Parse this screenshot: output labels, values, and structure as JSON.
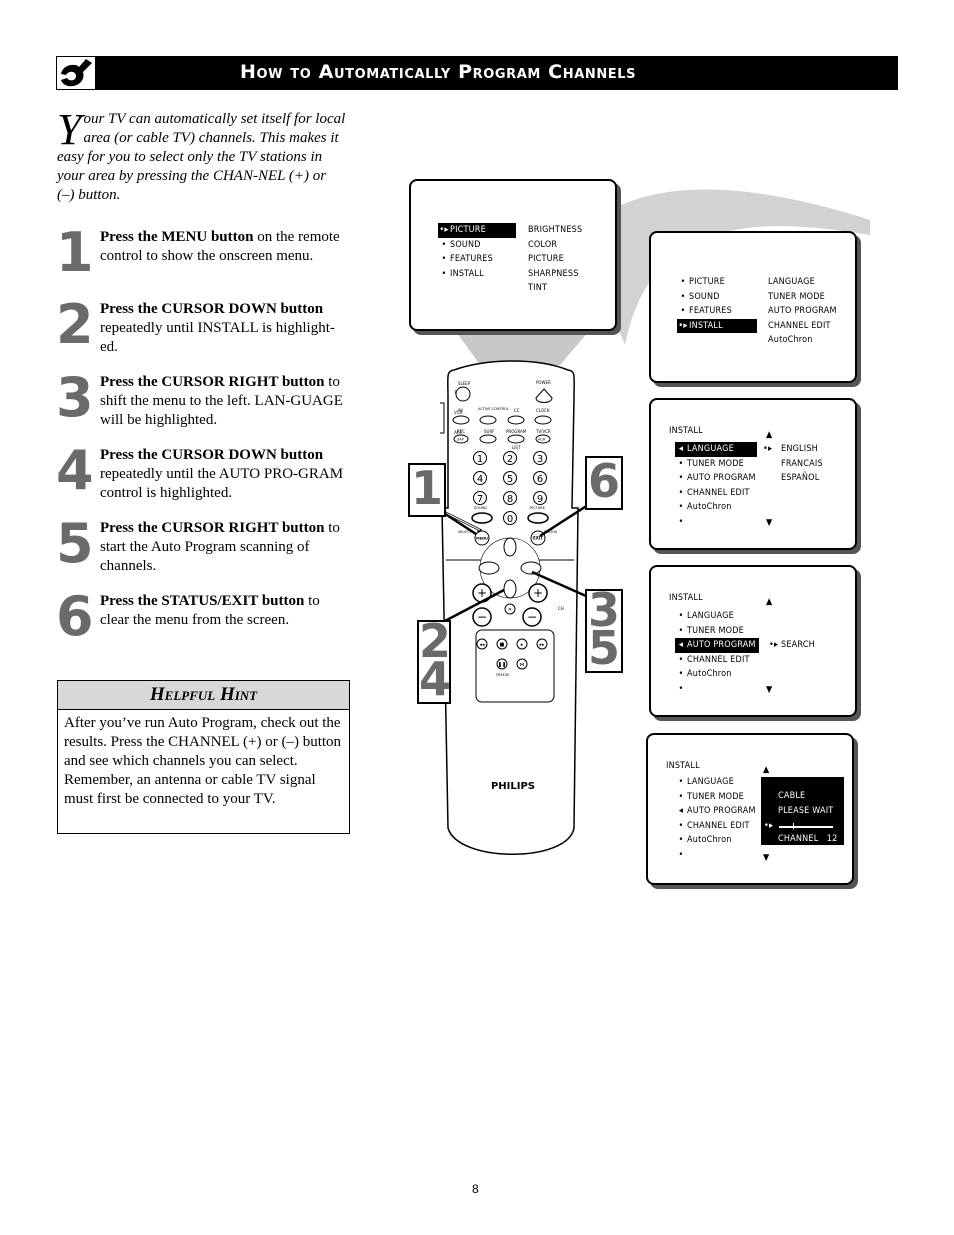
{
  "header": {
    "icon": "wrench-icon",
    "title": "How to Automatically Program Channels"
  },
  "intro": {
    "dropcap": "Y",
    "text": "our TV can automatically set itself for local area (or cable TV) channels.  This makes it easy for you to select only the TV stations in your area by pressing the CHAN-NEL (+) or (–) button."
  },
  "steps": [
    {
      "number": "1",
      "bold": "Press the MENU button",
      "text": " on the remote control to show the onscreen menu."
    },
    {
      "number": "2",
      "bold": "Press the CURSOR DOWN button",
      "text": " repeatedly until INSTALL is highlight-ed."
    },
    {
      "number": "3",
      "bold": "Press the CURSOR RIGHT button",
      "text": " to shift the menu to the left. LAN-GUAGE will be highlighted."
    },
    {
      "number": "4",
      "bold": "Press the CURSOR DOWN button",
      "text": " repeatedly until the AUTO PRO-GRAM control is highlighted."
    },
    {
      "number": "5",
      "bold": "Press the CURSOR RIGHT button",
      "text": " to start the Auto Program scanning of channels."
    },
    {
      "number": "6",
      "bold": "Press the STATUS/EXIT button",
      "text": " to clear the menu from the screen."
    }
  ],
  "hint": {
    "title": "Helpful Hint",
    "paragraphs": [
      "After you’ve run Auto Program, check out the results.  Press the CHANNEL (+) or (–) button and see which channels you can select.",
      "Remember, an antenna or cable TV signal must first be connected to your TV."
    ]
  },
  "screens": {
    "main_menu": {
      "left": [
        "PICTURE",
        "SOUND",
        "FEATURES",
        "INSTALL"
      ],
      "right": [
        "BRIGHTNESS",
        "COLOR",
        "PICTURE",
        "SHARPNESS",
        "TINT"
      ],
      "highlighted": "PICTURE"
    },
    "install_selected": {
      "left": [
        "PICTURE",
        "SOUND",
        "FEATURES",
        "INSTALL"
      ],
      "right": [
        "LANGUAGE",
        "TUNER MODE",
        "AUTO PROGRAM",
        "CHANNEL EDIT",
        "AutoChron"
      ],
      "highlighted": "INSTALL"
    },
    "language": {
      "title": "INSTALL",
      "items": [
        "LANGUAGE",
        "TUNER MODE",
        "AUTO PROGRAM",
        "CHANNEL EDIT",
        "AutoChron",
        ""
      ],
      "highlighted": "LANGUAGE",
      "options": [
        "ENGLISH",
        "FRANCAIS",
        "ESPAÑOL"
      ]
    },
    "auto_program": {
      "title": "INSTALL",
      "items": [
        "LANGUAGE",
        "TUNER MODE",
        "AUTO PROGRAM",
        "CHANNEL EDIT",
        "AutoChron",
        ""
      ],
      "highlighted": "AUTO PROGRAM",
      "option": "SEARCH"
    },
    "scanning": {
      "title": "INSTALL",
      "items": [
        "LANGUAGE",
        "TUNER MODE",
        "AUTO PROGRAM",
        "CHANNEL EDIT",
        "AutoChron",
        ""
      ],
      "status_lines": [
        "CABLE",
        "PLEASE WAIT"
      ],
      "channel_label": "CHANNEL",
      "channel_value": "12"
    }
  },
  "remote": {
    "brand": "PHILIPS",
    "labels": {
      "sleep": "SLEEP",
      "power": "POWER",
      "tv": "TV",
      "vcr": "VCR",
      "acc": "ACC",
      "av": "AV",
      "active_control": "ACTIVE CONTROL",
      "cc": "CC",
      "clock": "CLOCK",
      "rec": "REC",
      "sap": "SAP",
      "surf": "SURF",
      "program": "PROGRAM",
      "list": "LIST",
      "tv_vcr": "TV/VCR",
      "acr": "ACR",
      "sound": "SOUND",
      "picture": "PICTURE",
      "select": "SELECT",
      "menu": "MENU",
      "exit": "EXIT",
      "status": "STATUS",
      "ch": "CH",
      "freeze": "FREEZE"
    },
    "digits": [
      "1",
      "2",
      "3",
      "4",
      "5",
      "6",
      "7",
      "8",
      "9",
      "0"
    ]
  },
  "callouts": {
    "left_top": "1",
    "right_top": "6",
    "right_bottom": [
      "3",
      "5"
    ],
    "left_bottom": [
      "2",
      "4"
    ]
  },
  "page_number": "8"
}
